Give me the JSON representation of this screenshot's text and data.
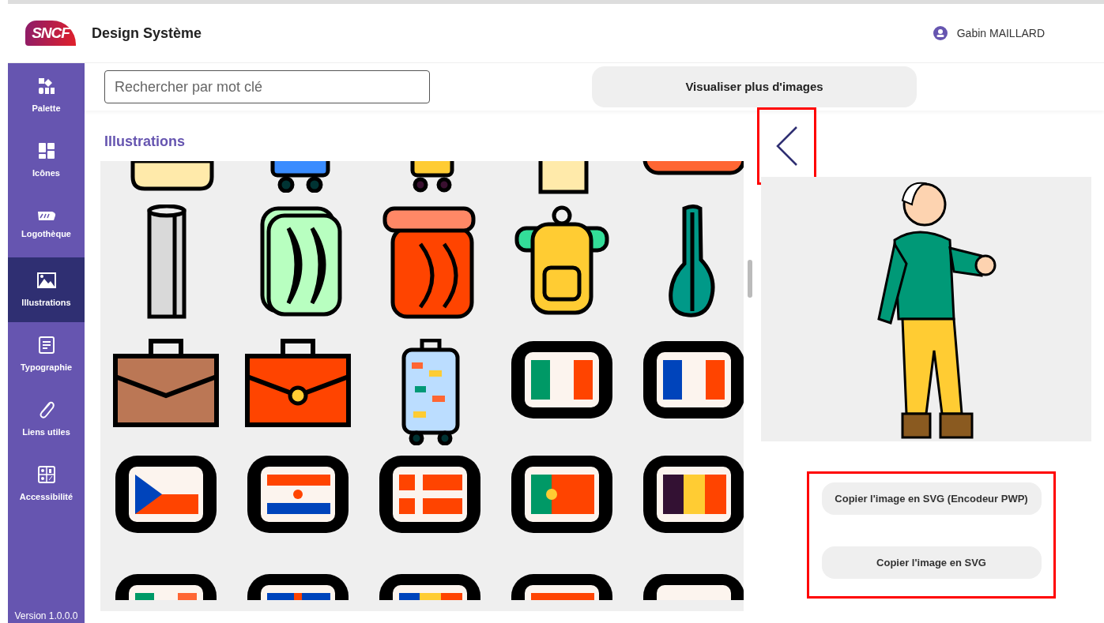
{
  "header": {
    "logo": "SNCF",
    "title": "Design Système",
    "user": "Gabin MAILLARD"
  },
  "sidebar": {
    "items": [
      {
        "label": "Palette",
        "selected": false
      },
      {
        "label": "Icônes",
        "selected": false
      },
      {
        "label": "Logothèque",
        "selected": false
      },
      {
        "label": "Illustrations",
        "selected": true
      },
      {
        "label": "Typographie",
        "selected": false
      },
      {
        "label": "Liens utiles",
        "selected": false
      },
      {
        "label": "Accessibilité",
        "selected": false
      }
    ],
    "version": "Version 1.0.0.0"
  },
  "search": {
    "placeholder": "Rechercher par mot clé"
  },
  "more_button": "Visualiser plus d'images",
  "section_title": "Illustrations",
  "preview": {
    "buttons": [
      "Copier l'image en SVG (Encodeur PWP)",
      "Copier l'image en SVG"
    ]
  }
}
